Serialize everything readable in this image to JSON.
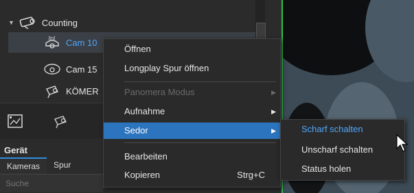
{
  "tree": {
    "group_label": "Counting",
    "items": [
      {
        "label": "Cam 10",
        "badge": "3rd"
      },
      {
        "label": "Cam 15"
      },
      {
        "label": "KÖMER"
      }
    ]
  },
  "panel": {
    "title": "Gerät",
    "tabs": [
      "Kameras",
      "Spur"
    ],
    "search_placeholder": "Suche"
  },
  "context_menu": {
    "items": [
      {
        "label": "Öffnen"
      },
      {
        "label": "Longplay Spur öffnen"
      },
      {
        "label": "Panomera Modus",
        "disabled": true,
        "submenu": true
      },
      {
        "label": "Aufnahme",
        "submenu": true
      },
      {
        "label": "Sedor",
        "submenu": true,
        "highlighted": true
      },
      {
        "label": "Bearbeiten"
      },
      {
        "label": "Kopieren",
        "shortcut": "Strg+C"
      }
    ]
  },
  "submenu": {
    "items": [
      {
        "label": "Scharf schalten",
        "highlighted": true
      },
      {
        "label": "Unscharf schalten"
      },
      {
        "label": "Status holen"
      }
    ]
  },
  "colors": {
    "accent": "#2c74bd",
    "divider_green": "#2cc44a",
    "selection_text": "#4fa8ff"
  }
}
